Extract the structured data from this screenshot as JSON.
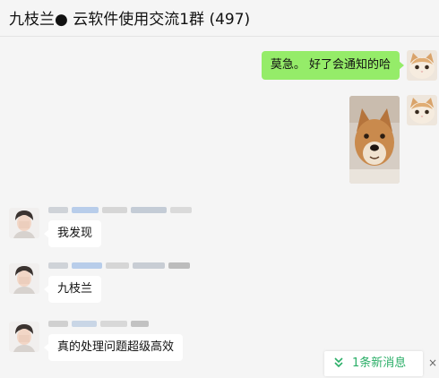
{
  "header": {
    "title": "九枝兰● 云软件使用交流1群 (497)"
  },
  "messages": {
    "outgoing_text": "莫急。 好了会通知的哈",
    "incoming": [
      {
        "text": "我发现"
      },
      {
        "text": "九枝兰"
      },
      {
        "text": "真的处理问题超级高效"
      }
    ]
  },
  "notice": {
    "new_messages": "1条新消息",
    "close_symbol": "×"
  },
  "colors": {
    "outgoing_bubble": "#95ec69",
    "incoming_bubble": "#ffffff",
    "background": "#f5f5f5",
    "accent_green": "#2aae67"
  }
}
